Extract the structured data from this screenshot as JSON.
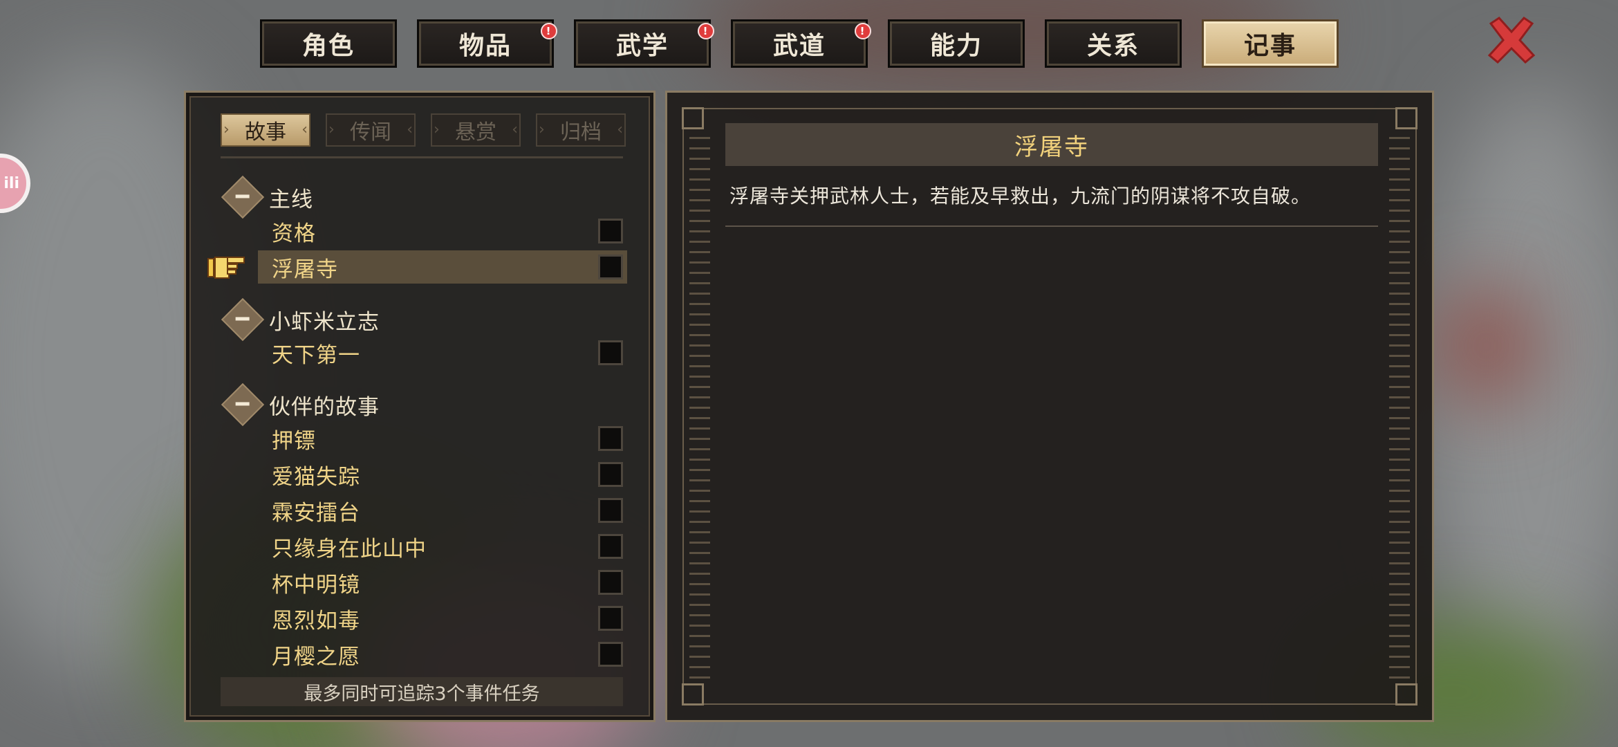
{
  "top_tabs": [
    {
      "label": "角色",
      "badge": false
    },
    {
      "label": "物品",
      "badge": true
    },
    {
      "label": "武学",
      "badge": true
    },
    {
      "label": "武道",
      "badge": true
    },
    {
      "label": "能力",
      "badge": false
    },
    {
      "label": "关系",
      "badge": false
    },
    {
      "label": "记事",
      "badge": false,
      "active": true
    }
  ],
  "badge_symbol": "!",
  "side_widget": "ili",
  "sub_tabs": [
    {
      "label": "故事",
      "active": true
    },
    {
      "label": "传闻"
    },
    {
      "label": "悬赏"
    },
    {
      "label": "归档"
    }
  ],
  "groups": [
    {
      "label": "主线",
      "items": [
        {
          "label": "资格"
        },
        {
          "label": "浮屠寺",
          "selected": true
        }
      ]
    },
    {
      "label": "小虾米立志",
      "items": [
        {
          "label": "天下第一"
        }
      ]
    },
    {
      "label": "伙伴的故事",
      "items": [
        {
          "label": "押镖"
        },
        {
          "label": "爱猫失踪"
        },
        {
          "label": "霖安擂台"
        },
        {
          "label": "只缘身在此山中"
        },
        {
          "label": "杯中明镜"
        },
        {
          "label": "恩烈如毒"
        },
        {
          "label": "月樱之愿"
        }
      ]
    }
  ],
  "footer_note": "最多同时可追踪3个事件任务",
  "detail": {
    "title": "浮屠寺",
    "text": "浮屠寺关押武林人士，若能及早救出，九流门的阴谋将不攻自破。"
  },
  "colors": {
    "accent_gold": "#f2d27c",
    "active_tab": "#d6bd8c",
    "badge_red": "#e03c3c",
    "close_red": "#d63a3a"
  }
}
